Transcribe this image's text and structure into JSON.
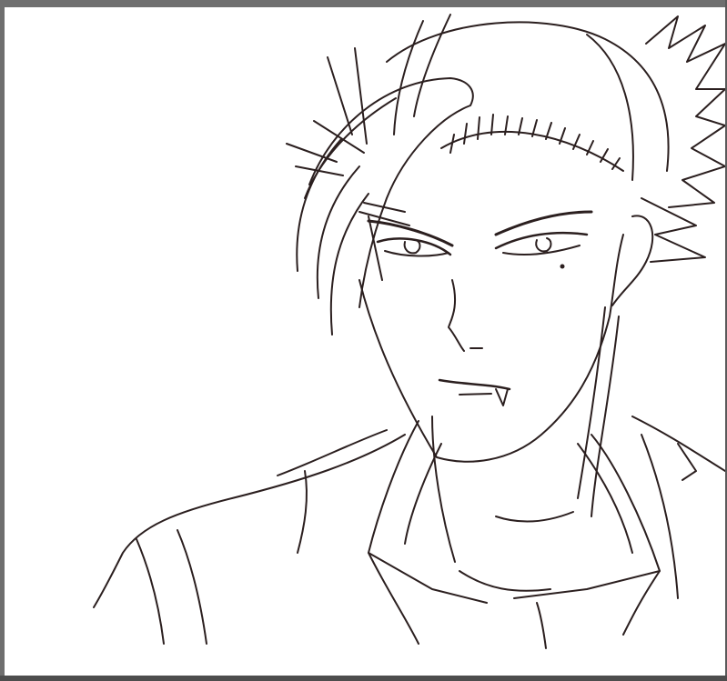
{
  "colors": {
    "frame": "#6f6f6f",
    "canvas": "#ffffff",
    "ink": "#2b1f1f"
  },
  "canvas": {
    "subject": "line-art-sketch"
  }
}
